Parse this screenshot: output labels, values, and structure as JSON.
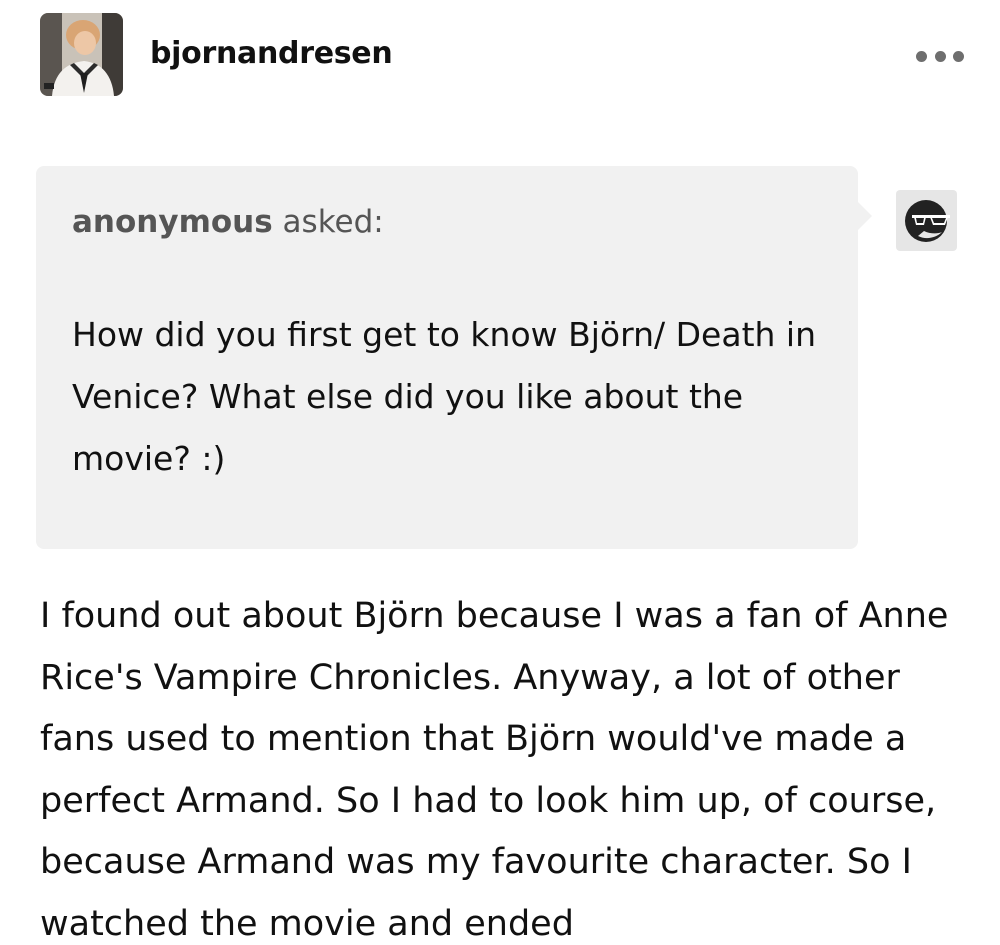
{
  "post": {
    "username": "bjornandresen",
    "more_icon": "ellipsis-icon",
    "avatar_icon": "user-avatar"
  },
  "ask": {
    "asker_name": "anonymous",
    "asker_suffix": "asked:",
    "question": "How did you first get to know Björn/ Death in Venice? What else did you like about the movie? :)",
    "asker_avatar_icon": "anonymous-sunglasses-icon"
  },
  "answer": {
    "text": "I found out about Björn because I was a fan of Anne Rice's Vampire Chronicles. Anyway, a lot of other fans used to mention that Björn would've made a perfect Armand. So I had to look him up, of course, because Armand was my favourite character. So I watched the movie and ended"
  },
  "colors": {
    "bubble_background": "#f1f1f1",
    "text": "#111111",
    "muted_text": "#555555",
    "dots": "#6e6e6e"
  }
}
